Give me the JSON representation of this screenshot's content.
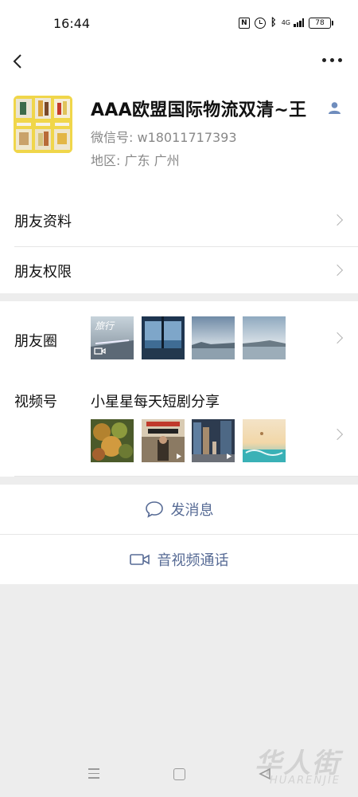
{
  "status_bar": {
    "time": "16:44",
    "network": "4G",
    "battery": "78",
    "icons": [
      "nfc-icon",
      "alarm-icon",
      "bluetooth-icon",
      "signal-icon",
      "battery-icon"
    ]
  },
  "header": {
    "back_icon": "chevron-left-icon",
    "more_icon": "ellipsis-icon"
  },
  "profile": {
    "name": "AAA欧盟国际物流双清~王",
    "wechat_id": "微信号: w18011717393",
    "region": "地区: 广东  广州",
    "name_badge_icon": "user-icon"
  },
  "menu": {
    "items": [
      {
        "label": "朋友资料"
      },
      {
        "label": "朋友权限"
      }
    ]
  },
  "moments": {
    "label": "朋友圈",
    "first_thumb_text": "旅行"
  },
  "channels": {
    "label": "视频号",
    "name": "小星星每天短剧分享"
  },
  "actions": {
    "message": "发消息",
    "call": "音视频通话"
  },
  "watermark": {
    "text": "华人街",
    "subtext": "HUARENJIE"
  },
  "colors": {
    "link": "#576b95",
    "background": "#ededed",
    "card": "#ffffff",
    "secondary_text": "#888888"
  }
}
